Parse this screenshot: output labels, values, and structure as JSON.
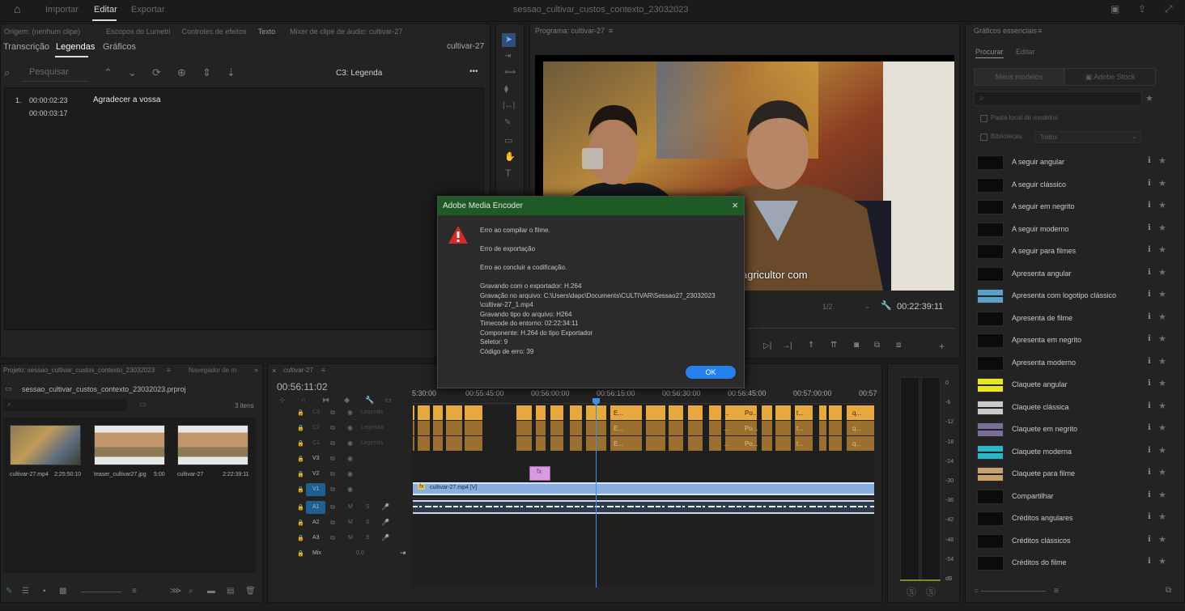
{
  "topbar": {
    "import": "Importar",
    "edit": "Editar",
    "export": "Exportar",
    "title": "sessao_cultivar_custos_contexto_23032023"
  },
  "source_tabs": {
    "items": [
      "Origem: (nenhum clipe)",
      "Escopos do Lumetri",
      "Controles de efeitos",
      "Texto",
      "Mixer de clipe de áudio: cultivar-27"
    ]
  },
  "text_panel": {
    "tabs": [
      "Transcrição",
      "Legendas",
      "Gráficos"
    ],
    "sequence": "cultivar-27",
    "search_placeholder": "Pesquisar",
    "track": "C3: Legenda",
    "menu": "•••",
    "caption": {
      "index": "1.",
      "in": "00:00:02:23",
      "out": "00:00:03:17",
      "text": "Agradecer a vossa"
    }
  },
  "program": {
    "title": "Programa: cultivar-27",
    "overlay_text": "agricultor com",
    "zoom": "1/2",
    "timecode": "00:22:39:11"
  },
  "graphics": {
    "title": "Gráficos essenciais",
    "tabs": [
      "Procurar",
      "Editar"
    ],
    "btn_my": "Meus modelos",
    "btn_stock": "Adobe Stock",
    "chk_local": "Pasta local de modelos",
    "chk_libs": "Bibliotecas",
    "libs_sel": "Todos",
    "items": [
      "A seguir angular",
      "A seguir clássico",
      "A seguir em negrito",
      "A seguir moderno",
      "A seguir para filmes",
      "Apresenta angular",
      "Apresenta com logotipo clássico",
      "Apresenta de filme",
      "Apresenta em negrito",
      "Apresenta moderno",
      "Claquete angular",
      "Claquete clássica",
      "Claquete em negrito",
      "Claquete moderna",
      "Claquete para filme",
      "Compartilhar",
      "Créditos angulares",
      "Créditos clássicos",
      "Créditos do filme"
    ]
  },
  "project": {
    "title": "Projeto: sessao_cultivar_custos_contexto_23032023",
    "nav": "Navegador de m",
    "file": "sessao_cultivar_custos_contexto_23032023.prproj",
    "count": "3 itens",
    "items": [
      {
        "name": "cultivar-27.mp4",
        "dur": "2:25:50:10"
      },
      {
        "name": "teaser_cultivar27.jpg",
        "dur": "5:00"
      },
      {
        "name": "cultivar-27",
        "dur": "2:22:39:11"
      }
    ]
  },
  "timeline": {
    "tab": "cultivar-27",
    "timecode": "00:56:11:02",
    "ruler": [
      "5:30:00",
      "00:55:45:00",
      "00:56:00:00",
      "00:56:15:00",
      "00:56:30:00",
      "00:56:45:00",
      "00:57:00:00",
      "00:57"
    ],
    "tracks": [
      "C3",
      "C2",
      "C1",
      "V3",
      "V2",
      "V1",
      "A1",
      "A2",
      "A3",
      "Mix"
    ],
    "caption_label": "Legenda",
    "mix_val": "0,0",
    "clip_label": "cultivar-27.mp4 [V]",
    "cap_texts": [
      "E...",
      "...",
      "Po...",
      "t...",
      "q..."
    ]
  },
  "meter": {
    "labels": [
      "0",
      "-6",
      "-12",
      "-18",
      "-24",
      "-30",
      "-36",
      "-42",
      "-48",
      "-54",
      "dB"
    ],
    "solo": "S"
  },
  "dialog": {
    "title": "Adobe Media Encoder",
    "l1": "Erro ao compilar o filme.",
    "l2": "Erro de exportação",
    "l3": "Erro ao concluir a codificação.",
    "d1": "Gravando com o exportador: H.264",
    "d2": "Gravação no arquivo: C:\\Users\\dapc\\Documents\\CULTIVAR\\Sessao27_23032023",
    "d3": "\\cultivar-27_1.mp4",
    "d4": "Gravando tipo do arquivo: H264",
    "d5": "Timecode do entorno: 02:22:34:11",
    "d6": "Componente: H.264 do tipo Exportador",
    "d7": "Seletor: 9",
    "d8": "Código de erro: 39",
    "ok": "OK"
  },
  "colors": {
    "accent": "#2680eb",
    "dialog_header": "#1e5a26",
    "caption_track": "#e8a840",
    "video_clip": "#8aaee0",
    "warning": "#d42a2a"
  }
}
